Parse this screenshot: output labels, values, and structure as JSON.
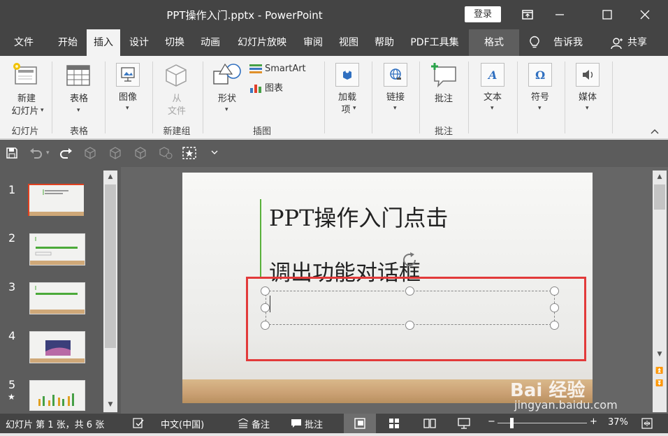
{
  "titlebar": {
    "title": "PPT操作入门.pptx  -  PowerPoint",
    "login": "登录"
  },
  "tabs": [
    "文件",
    "开始",
    "插入",
    "设计",
    "切换",
    "动画",
    "幻灯片放映",
    "审阅",
    "视图",
    "帮助",
    "PDF工具集",
    "格式"
  ],
  "tell_me": "告诉我",
  "share": "共享",
  "ribbon": {
    "new_slide": [
      "新建",
      "幻灯片"
    ],
    "table": "表格",
    "image": "图像",
    "from_file": [
      "从",
      "文件"
    ],
    "shapes": "形状",
    "smartart": "SmartArt",
    "chart": "图表",
    "addin": [
      "加载",
      "项"
    ],
    "link": "链接",
    "comment": "批注",
    "text": "文本",
    "symbol": "符号",
    "media": "媒体",
    "groups": {
      "slides": "幻灯片",
      "tables": "表格",
      "newgroup": "新建组",
      "illustrations": "插图",
      "comments": "批注"
    }
  },
  "slides": {
    "numbers": [
      "1",
      "2",
      "3",
      "4",
      "5"
    ],
    "star": "★"
  },
  "slide": {
    "title_line1": "PPT操作入门点击",
    "title_line2": "调出功能对话框"
  },
  "status": {
    "slide_info": "幻灯片 第 1 张，共 6 张",
    "language": "中文(中国)",
    "notes": "备注",
    "comments": "批注",
    "zoom": "37%"
  },
  "watermark": {
    "brand": "Bai 经验",
    "url": "jingyan.baidu.com"
  },
  "colors": {
    "title_bg": "#444444",
    "accent_red": "#e0401f",
    "highlight_box": "#e23a3a"
  }
}
